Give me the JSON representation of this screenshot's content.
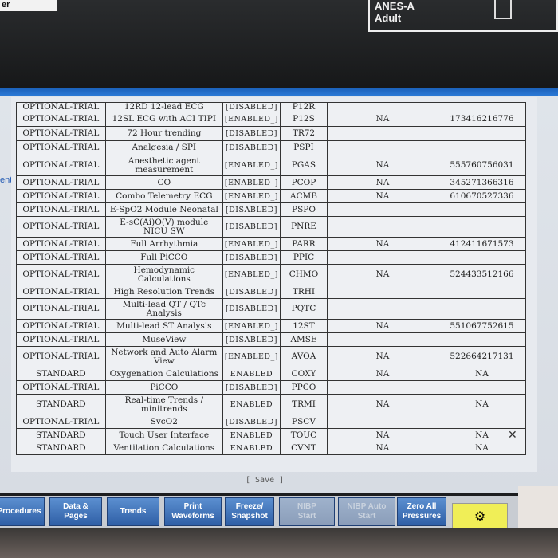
{
  "top_left_text": "er",
  "top_right": {
    "line1": "ANES-A",
    "line2": "Adult"
  },
  "left_cut_text": "ent",
  "table": {
    "partial_row": [
      "OPTIONAL-TRIAL",
      "12RD 12-lead ECG",
      "[DISABLED]",
      "P12R",
      "",
      ""
    ],
    "rows": [
      [
        "OPTIONAL-TRIAL",
        "12SL ECG with ACI TIPI",
        "[ENABLED_]",
        "P12S",
        "NA",
        "173416216776"
      ],
      [
        "OPTIONAL-TRIAL",
        "72 Hour trending",
        "[DISABLED]",
        "TR72",
        "",
        ""
      ],
      [
        "OPTIONAL-TRIAL",
        "Analgesia / SPI",
        "[DISABLED]",
        "PSPI",
        "",
        ""
      ],
      [
        "OPTIONAL-TRIAL",
        "Anesthetic agent measurement",
        "[ENABLED_]",
        "PGAS",
        "NA",
        "555760756031"
      ],
      [
        "OPTIONAL-TRIAL",
        "CO",
        "[ENABLED_]",
        "PCOP",
        "NA",
        "345271366316"
      ],
      [
        "OPTIONAL-TRIAL",
        "Combo Telemetry ECG",
        "[ENABLED_]",
        "ACMB",
        "NA",
        "610670527336"
      ],
      [
        "OPTIONAL-TRIAL",
        "E-SpO2 Module Neonatal",
        "[DISABLED]",
        "PSPO",
        "",
        ""
      ],
      [
        "OPTIONAL-TRIAL",
        "E-sC(Ai)O(V) module NICU SW",
        "[DISABLED]",
        "PNRE",
        "",
        ""
      ],
      [
        "OPTIONAL-TRIAL",
        "Full Arrhythmia",
        "[ENABLED_]",
        "PARR",
        "NA",
        "412411671573"
      ],
      [
        "OPTIONAL-TRIAL",
        "Full PiCCO",
        "[DISABLED]",
        "PPIC",
        "",
        ""
      ],
      [
        "OPTIONAL-TRIAL",
        "Hemodynamic Calculations",
        "[ENABLED_]",
        "CHMO",
        "NA",
        "524433512166"
      ],
      [
        "OPTIONAL-TRIAL",
        "High Resolution Trends",
        "[DISABLED]",
        "TRHI",
        "",
        ""
      ],
      [
        "OPTIONAL-TRIAL",
        "Multi-lead QT / QTc Analysis",
        "[DISABLED]",
        "PQTC",
        "",
        ""
      ],
      [
        "OPTIONAL-TRIAL",
        "Multi-lead ST Analysis",
        "[ENABLED_]",
        "12ST",
        "NA",
        "551067752615"
      ],
      [
        "OPTIONAL-TRIAL",
        "MuseView",
        "[DISABLED]",
        "AMSE",
        "",
        ""
      ],
      [
        "OPTIONAL-TRIAL",
        "Network and Auto Alarm View",
        "[ENABLED_]",
        "AVOA",
        "NA",
        "522664217131"
      ],
      [
        "STANDARD",
        "Oxygenation Calculations",
        "ENABLED",
        "COXY",
        "NA",
        "NA"
      ],
      [
        "OPTIONAL-TRIAL",
        "PiCCO",
        "[DISABLED]",
        "PPCO",
        "",
        ""
      ],
      [
        "STANDARD",
        "Real-time Trends / minitrends",
        "ENABLED",
        "TRMI",
        "NA",
        "NA"
      ],
      [
        "OPTIONAL-TRIAL",
        "SvcO2",
        "[DISABLED]",
        "PSCV",
        "",
        ""
      ],
      [
        "STANDARD",
        "Touch User Interface",
        "ENABLED",
        "TOUC",
        "NA",
        "NA"
      ],
      [
        "STANDARD",
        "Ventilation Calculations",
        "ENABLED",
        "CVNT",
        "NA",
        "NA"
      ]
    ]
  },
  "save_label": "[ Save ]",
  "buttons": {
    "procedures": "Procedures",
    "data_pages": "Data &\nPages",
    "trends": "Trends",
    "print_waveforms": "Print\nWaveforms",
    "freeze_snapshot": "Freeze/\nSnapshot",
    "nibp_start": "NIBP\nStart",
    "nibp_auto_start": "NIBP Auto\nStart",
    "zero_all_pressures": "Zero All\nPressures"
  },
  "colors": {
    "accent_blue": "#2b79d6",
    "alarm_yellow": "#f0ee57"
  }
}
